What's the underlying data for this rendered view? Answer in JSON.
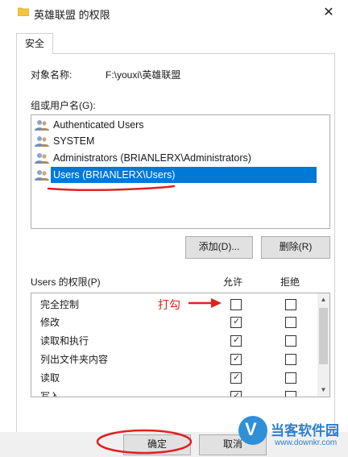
{
  "window": {
    "title": "英雄联盟 的权限",
    "close_glyph": "✕"
  },
  "tabs": [
    {
      "label": "安全"
    }
  ],
  "object": {
    "label": "对象名称:",
    "value": "F:\\youxi\\英雄联盟"
  },
  "groups": {
    "label": "组或用户名(G):",
    "items": [
      {
        "label": "Authenticated Users",
        "selected": false
      },
      {
        "label": "SYSTEM",
        "selected": false
      },
      {
        "label": "Administrators (BRIANLERX\\Administrators)",
        "selected": false
      },
      {
        "label": "Users (BRIANLERX\\Users)",
        "selected": true
      }
    ]
  },
  "buttons": {
    "add": "添加(D)...",
    "remove": "删除(R)",
    "ok": "确定",
    "cancel": "取消"
  },
  "permissions": {
    "label": "Users 的权限(P)",
    "allow_header": "允许",
    "deny_header": "拒绝",
    "rows": [
      {
        "name": "完全控制",
        "allow": false,
        "deny": false
      },
      {
        "name": "修改",
        "allow": true,
        "deny": false
      },
      {
        "name": "读取和执行",
        "allow": true,
        "deny": false
      },
      {
        "name": "列出文件夹内容",
        "allow": true,
        "deny": false
      },
      {
        "name": "读取",
        "allow": true,
        "deny": false
      },
      {
        "name": "写入",
        "allow": true,
        "deny": false
      }
    ]
  },
  "annotation": {
    "text": "打勾",
    "color": "#e02020"
  },
  "watermark": {
    "logo_glyph": "V",
    "text": "当客软件园",
    "url": "www.downkr.com"
  },
  "colors": {
    "selection": "#0078d7",
    "annotation_red": "#e02020"
  }
}
